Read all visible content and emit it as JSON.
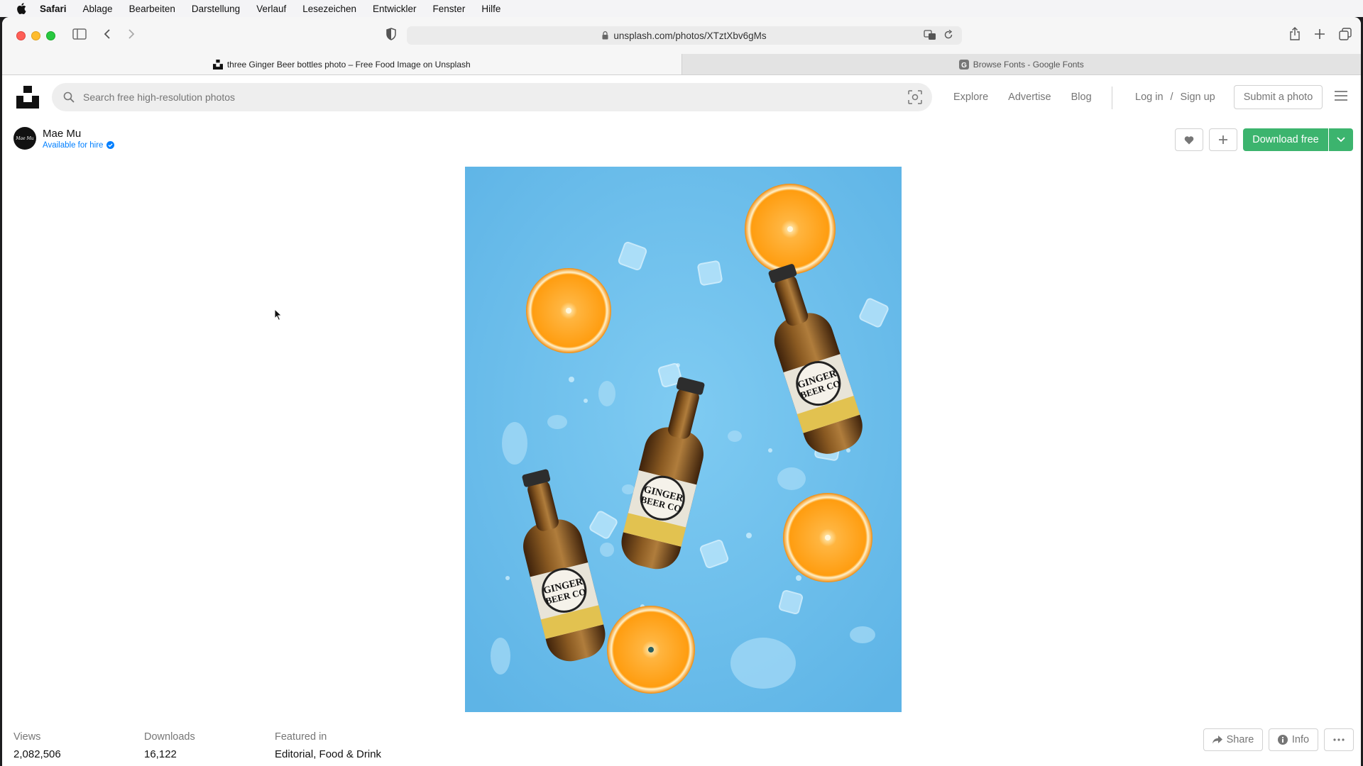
{
  "menubar": {
    "app_name": "Safari",
    "items": [
      "Ablage",
      "Bearbeiten",
      "Darstellung",
      "Verlauf",
      "Lesezeichen",
      "Entwickler",
      "Fenster",
      "Hilfe"
    ]
  },
  "browser": {
    "url": "unsplash.com/photos/XTztXbv6gMs",
    "tabs": [
      {
        "title": "three Ginger Beer bottles photo – Free Food Image on Unsplash",
        "active": true
      },
      {
        "title": "Browse Fonts - Google Fonts",
        "active": false
      }
    ]
  },
  "header": {
    "search_placeholder": "Search free high-resolution photos",
    "nav": [
      "Explore",
      "Advertise",
      "Blog"
    ],
    "login": "Log in",
    "slash": "/",
    "signup": "Sign up",
    "submit": "Submit a photo"
  },
  "author": {
    "name": "Mae Mu",
    "status": "Available for hire",
    "avatar_text": "Mae Mu"
  },
  "actions": {
    "download": "Download free"
  },
  "stats": {
    "views_label": "Views",
    "views": "2,082,506",
    "downloads_label": "Downloads",
    "downloads": "16,122",
    "featured_label": "Featured in",
    "featured": "Editorial, Food & Drink"
  },
  "footer_actions": {
    "share": "Share",
    "info": "Info"
  },
  "photo": {
    "label_line1": "GINGER",
    "label_line2": "BEER CO",
    "background_color": "#6cc0ec"
  },
  "colors": {
    "accent_green": "#3cb46e",
    "link_blue": "#007fff"
  }
}
